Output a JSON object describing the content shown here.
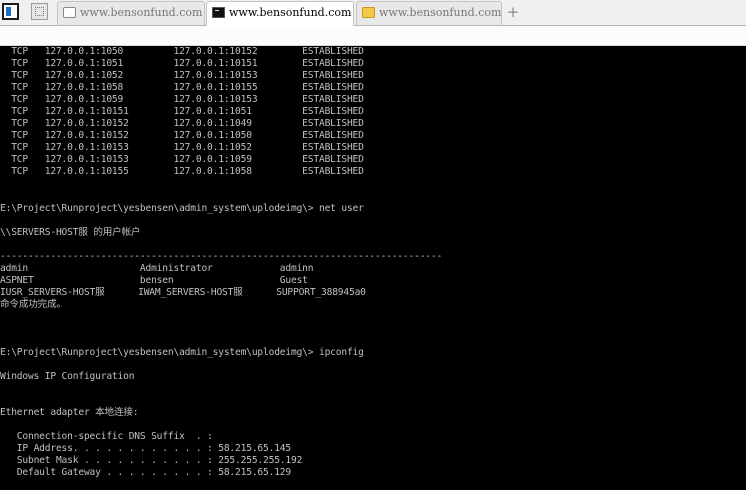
{
  "tabs": [
    {
      "label": "www.bensonfund.com",
      "icon": "page-icon",
      "active": false
    },
    {
      "label": "www.bensonfund.com",
      "icon": "cmd-icon",
      "active": true
    },
    {
      "label": "www.bensonfund.com",
      "icon": "folder-icon",
      "active": false
    }
  ],
  "new_tab_label": "+",
  "terminal": {
    "netstat_rows": [
      {
        "proto": "TCP",
        "local": "127.0.0.1:1050",
        "foreign": "127.0.0.1:10152",
        "state": "ESTABLISHED"
      },
      {
        "proto": "TCP",
        "local": "127.0.0.1:1051",
        "foreign": "127.0.0.1:10151",
        "state": "ESTABLISHED"
      },
      {
        "proto": "TCP",
        "local": "127.0.0.1:1052",
        "foreign": "127.0.0.1:10153",
        "state": "ESTABLISHED"
      },
      {
        "proto": "TCP",
        "local": "127.0.0.1:1058",
        "foreign": "127.0.0.1:10155",
        "state": "ESTABLISHED"
      },
      {
        "proto": "TCP",
        "local": "127.0.0.1:1059",
        "foreign": "127.0.0.1:10153",
        "state": "ESTABLISHED"
      },
      {
        "proto": "TCP",
        "local": "127.0.0.1:10151",
        "foreign": "127.0.0.1:1051",
        "state": "ESTABLISHED"
      },
      {
        "proto": "TCP",
        "local": "127.0.0.1:10152",
        "foreign": "127.0.0.1:1049",
        "state": "ESTABLISHED"
      },
      {
        "proto": "TCP",
        "local": "127.0.0.1:10152",
        "foreign": "127.0.0.1:1050",
        "state": "ESTABLISHED"
      },
      {
        "proto": "TCP",
        "local": "127.0.0.1:10153",
        "foreign": "127.0.0.1:1052",
        "state": "ESTABLISHED"
      },
      {
        "proto": "TCP",
        "local": "127.0.0.1:10153",
        "foreign": "127.0.0.1:1059",
        "state": "ESTABLISHED"
      },
      {
        "proto": "TCP",
        "local": "127.0.0.1:10155",
        "foreign": "127.0.0.1:1058",
        "state": "ESTABLISHED"
      }
    ],
    "prompt_net_user": "E:\\Project\\Runproject\\yesbensen\\admin_system\\uplodeimg\\> net user",
    "user_accounts_title": "\\\\SERVERS-HOST服 的用户帐户",
    "separator": "-------------------------------------------------------------------------------",
    "user_rows": [
      [
        "admin",
        "Administrator",
        "adminn"
      ],
      [
        "ASPNET",
        "bensen",
        "Guest"
      ],
      [
        "IUSR_SERVERS-HOST服",
        "IWAM_SERVERS-HOST服",
        "SUPPORT_388945a0"
      ]
    ],
    "command_success": "命令成功完成。",
    "prompt_ipconfig": "E:\\Project\\Runproject\\yesbensen\\admin_system\\uplodeimg\\> ipconfig",
    "ip_config_title": "Windows IP Configuration",
    "adapter_title": "Ethernet adapter 本地连接:",
    "ip_rows": [
      "   Connection-specific DNS Suffix  . :",
      "   IP Address. . . . . . . . . . . . : 58.215.65.145",
      "   Subnet Mask . . . . . . . . . . . : 255.255.255.192",
      "   Default Gateway . . . . . . . . . : 58.215.65.129"
    ]
  },
  "colors": {
    "terminal_bg": "#000000",
    "terminal_text": "#c0c0c0",
    "tabbar_bg": "#f0f0f0"
  }
}
